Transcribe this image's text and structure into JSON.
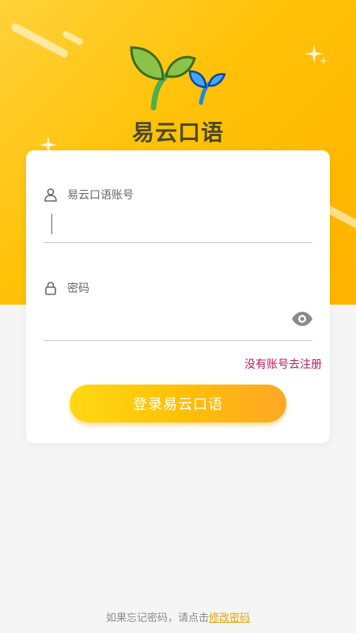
{
  "app": {
    "brand_name": "易云口语"
  },
  "login_form": {
    "account_placeholder": "易云口语账号",
    "account_value": "",
    "password_placeholder": "密码",
    "password_value": "",
    "register_link": "没有账号去注册",
    "login_button": "登录易云口语"
  },
  "footer": {
    "hint_text": "如果忘记密码，请点击",
    "reset_link": "修改密码"
  },
  "icons": {
    "account": "user-icon",
    "password": "lock-icon",
    "toggle_password": "eye-icon",
    "logo": "sprout-logo-icon"
  },
  "colors": {
    "hero_yellow": "#ffc107",
    "register_link": "#c2185b",
    "reset_link": "#e5a400",
    "button_start": "#ffd814",
    "button_end": "#ffa726"
  }
}
